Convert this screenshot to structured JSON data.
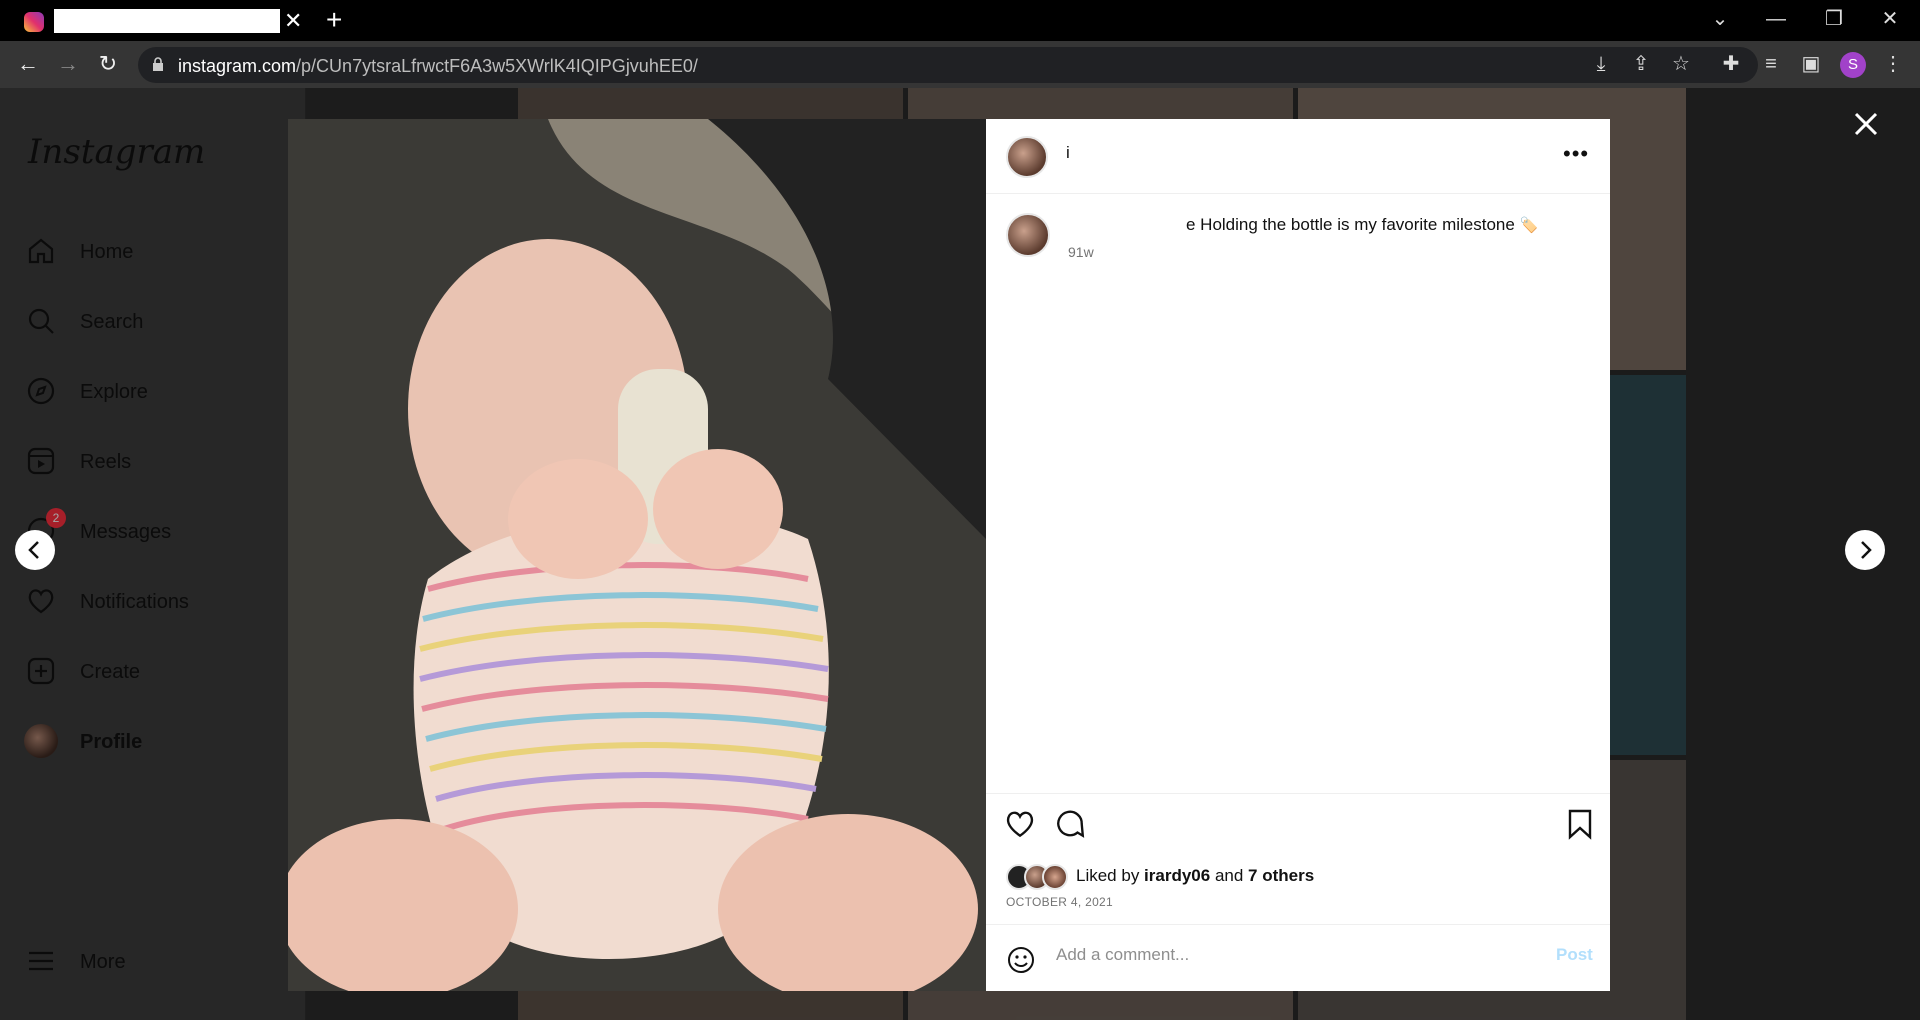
{
  "browser": {
    "url_domain": "instagram.com",
    "url_path": "/p/CUn7ytsraLfrwctF6A3w5XWrlK4IQIPGjvuhEE0/",
    "profile_initial": "S"
  },
  "sidebar": {
    "logo": "Instagram",
    "items": [
      {
        "label": "Home",
        "icon": "home-icon"
      },
      {
        "label": "Search",
        "icon": "search-icon"
      },
      {
        "label": "Explore",
        "icon": "compass-icon"
      },
      {
        "label": "Reels",
        "icon": "reels-icon"
      },
      {
        "label": "Messages",
        "icon": "messenger-icon",
        "badge": "2"
      },
      {
        "label": "Notifications",
        "icon": "heart-icon"
      },
      {
        "label": "Create",
        "icon": "plus-square-icon"
      },
      {
        "label": "Profile",
        "icon": "avatar"
      }
    ],
    "more": "More"
  },
  "post": {
    "username": "i",
    "caption": "e Holding the bottle is my favorite milestone",
    "caption_emoji": "🏷️",
    "age": "91w",
    "liked_prefix": "Liked by ",
    "liked_user": "irardy06",
    "liked_mid": " and ",
    "liked_others": "7 others",
    "date": "OCTOBER 4, 2021",
    "comment_placeholder": "Add a comment...",
    "post_button": "Post"
  }
}
